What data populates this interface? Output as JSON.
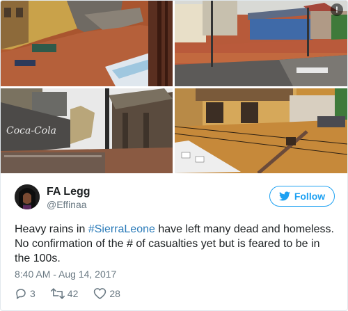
{
  "photos": [
    {
      "name": "flooded street with buildings"
    },
    {
      "name": "flooded neighborhood rooftops"
    },
    {
      "name": "flooded street with coca-cola sign"
    },
    {
      "name": "flooded houses and car"
    }
  ],
  "author": {
    "display_name": "FA Legg",
    "handle": "@Effinaa"
  },
  "follow_button": {
    "label": "Follow"
  },
  "tweet": {
    "text_before": "Heavy rains in ",
    "hashtag": "#SierraLeone",
    "text_after": " have left many dead and homeless. No confirmation of the # of casualties yet but is feared to be in the 100s.",
    "timestamp": "8:40 AM - Aug 14, 2017"
  },
  "actions": {
    "replies": "3",
    "retweets": "42",
    "likes": "28"
  },
  "colors": {
    "accent": "#1da1f2",
    "hashtag": "#2b7bb9",
    "muted": "#697882"
  },
  "icons": [
    "info-icon",
    "twitter-bird-icon",
    "reply-icon",
    "retweet-icon",
    "heart-icon"
  ]
}
